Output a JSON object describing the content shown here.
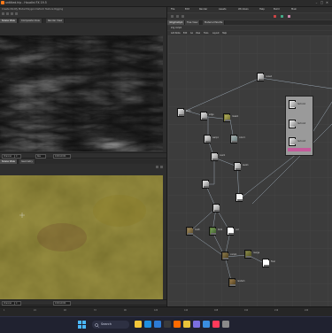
{
  "window": {
    "title": "untitled.hip - Houdini FX 19.5",
    "controls": [
      "–",
      "□",
      "✕"
    ]
  },
  "left": {
    "shelf_label": "Create  Modify  Model  Polygon  Deform  Texture  Rigging",
    "tabs": [
      "Scene View",
      "Composite View",
      "Render View"
    ],
    "viewport1_bar": [
      "Channel",
      "C",
      "Res",
      "1024x1024"
    ],
    "viewport2_tabs": [
      "Scene View",
      "Geometry"
    ],
    "viewport2_bar": [
      "Channel",
      "C",
      "1024x1024"
    ]
  },
  "right": {
    "menus": [
      "File",
      "Edit",
      "Render",
      "Assets",
      "Windows",
      "Help",
      "Build",
      "Main"
    ],
    "tabs": [
      "/img/comp1",
      "Tree View",
      "Material Palette"
    ],
    "path": "img  comp1",
    "net_labels": [
      "Add Node",
      "Edit",
      "Go",
      "View",
      "Tools",
      "Layout",
      "Help"
    ]
  },
  "nodes": [
    {
      "name": "noise1",
      "tint": "#e0e0e0"
    },
    {
      "name": "blur1",
      "tint": "#d0d0d0"
    },
    {
      "name": "edge",
      "tint": "#cfcfcf"
    },
    {
      "name": "warp1",
      "tint": "#c8c8c8"
    },
    {
      "name": "mask1",
      "tint": "#7c7e3a"
    },
    {
      "name": "color1",
      "tint": "#9aa0a0"
    },
    {
      "name": "over1",
      "tint": "#bcbcbc"
    },
    {
      "name": "level1",
      "tint": "#d8d8d8"
    },
    {
      "name": "multi",
      "tint": "#7a6a4a"
    },
    {
      "name": "tint1",
      "tint": "#5a7a3a"
    },
    {
      "name": "out",
      "tint": "#ffffff"
    },
    {
      "name": "comp1",
      "tint": "#6a5a3a"
    },
    {
      "name": "merge",
      "tint": "#6a6a3a"
    },
    {
      "name": "final",
      "tint": "#ffffff"
    },
    {
      "name": "render1",
      "tint": "#6a5a3a"
    }
  ],
  "param_panel": {
    "items": [
      "texture1",
      "texture2",
      "texture3"
    ]
  },
  "timeline": {
    "ticks": [
      "1",
      "24",
      "48",
      "72",
      "96",
      "120",
      "144",
      "168",
      "192",
      "216",
      "240"
    ]
  },
  "taskbar": {
    "search_placeholder": "Search",
    "icons": [
      {
        "name": "file-explorer-icon",
        "color": "#f4c63a"
      },
      {
        "name": "edge-browser-icon",
        "color": "#1f8fe0"
      },
      {
        "name": "store-icon",
        "color": "#2d7bd6"
      },
      {
        "name": "terminal-icon",
        "color": "#3a3a3a"
      },
      {
        "name": "houdini-icon",
        "color": "#ff6a00"
      },
      {
        "name": "chrome-icon",
        "color": "#e8c23a"
      },
      {
        "name": "photos-icon",
        "color": "#7b6fe0"
      },
      {
        "name": "mail-icon",
        "color": "#3a8ee0"
      },
      {
        "name": "music-icon",
        "color": "#ff3a5a"
      },
      {
        "name": "settings-icon",
        "color": "#8a8a8a"
      }
    ],
    "clock": "12:00",
    "date": "01/01/2024"
  },
  "colors": {
    "accent": "#ff7a1a",
    "viewport_bg": "#0e0e0e",
    "network_bg": "#3c3c3c"
  }
}
